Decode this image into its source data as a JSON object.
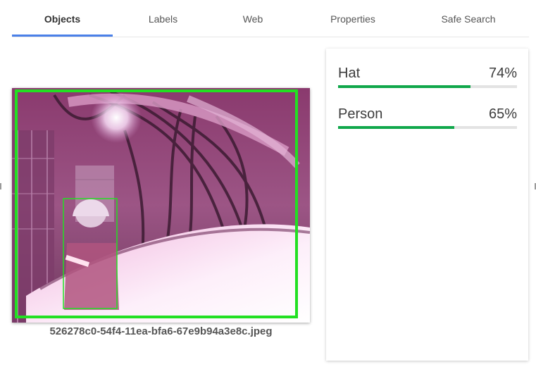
{
  "tabs": [
    {
      "label": "Objects",
      "active": true
    },
    {
      "label": "Labels",
      "active": false
    },
    {
      "label": "Web",
      "active": false
    },
    {
      "label": "Properties",
      "active": false
    },
    {
      "label": "Safe Search",
      "active": false
    }
  ],
  "image": {
    "filename": "526278c0-54f4-11ea-bfa6-67e9b94a3e8c.jpeg",
    "box_color": "#22e022",
    "tint_color": "#a0507a"
  },
  "results": [
    {
      "name": "Hat",
      "score": "74%",
      "confidence": 0.74
    },
    {
      "name": "Person",
      "score": "65%",
      "confidence": 0.65
    }
  ],
  "colors": {
    "accent": "#4a80e8",
    "confidence_bar": "#10a74b",
    "track": "#e3e3e3"
  }
}
